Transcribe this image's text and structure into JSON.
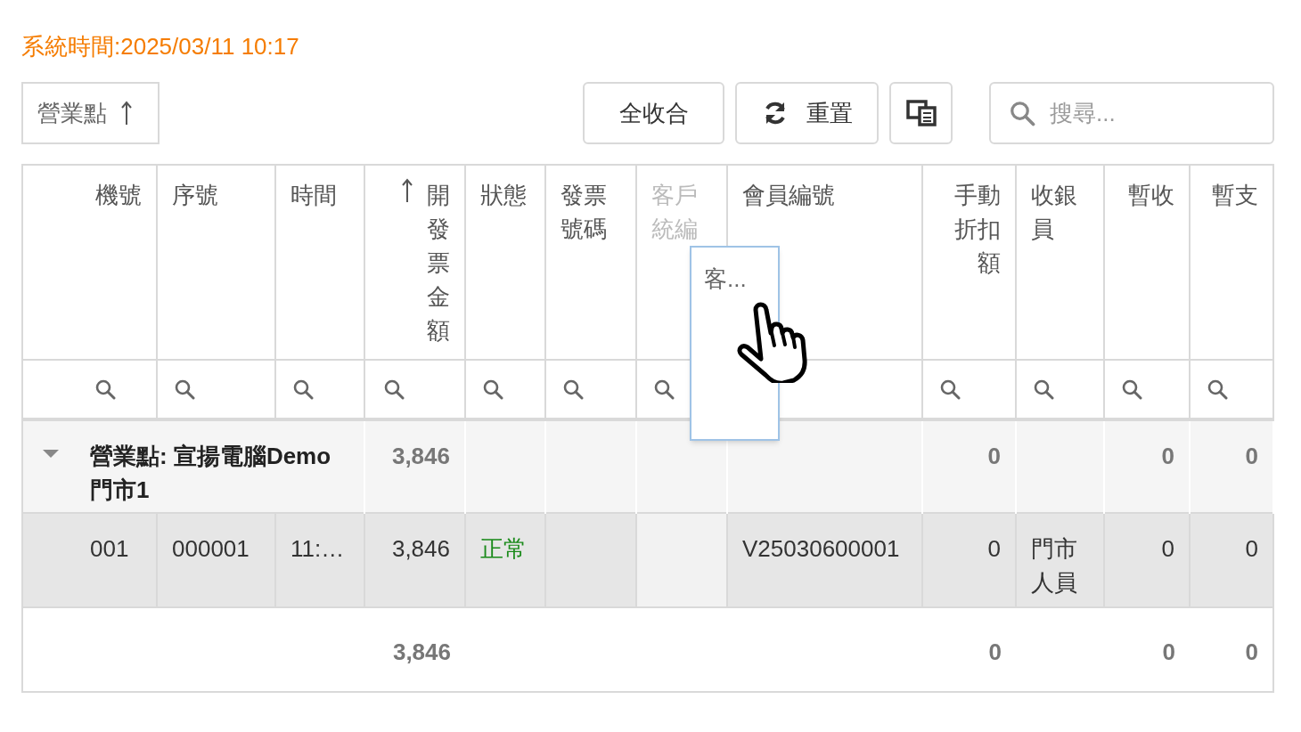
{
  "system_time": "系統時間:2025/03/11 10:17",
  "group_by": {
    "label": "營業點",
    "sorted_ascending": true
  },
  "toolbar": {
    "buttons": [
      {
        "kind": "text",
        "label": "全收合"
      },
      {
        "kind": "refresh",
        "label": "重置"
      },
      {
        "kind": "column-chooser"
      }
    ]
  },
  "search": {
    "placeholder": "搜尋..."
  },
  "table": {
    "columns": [
      {
        "label": "機號",
        "kind": "code",
        "sorted_ascending": false,
        "dragging": false
      },
      {
        "label": "序號",
        "kind": "text",
        "sorted_ascending": false,
        "dragging": false
      },
      {
        "label": "時間",
        "kind": "text",
        "sorted_ascending": false,
        "dragging": false
      },
      {
        "label": "開發票金額",
        "kind": "number",
        "sorted_ascending": true,
        "dragging": false
      },
      {
        "label": "狀態",
        "kind": "status",
        "sorted_ascending": false,
        "dragging": false
      },
      {
        "label": "發票號碼",
        "kind": "text",
        "sorted_ascending": false,
        "dragging": false
      },
      {
        "label": "客戶統編",
        "kind": "text",
        "sorted_ascending": false,
        "dragging": true
      },
      {
        "label": "會員編號",
        "kind": "text",
        "sorted_ascending": false,
        "dragging": false
      },
      {
        "label": "手動折扣額",
        "kind": "number",
        "sorted_ascending": false,
        "dragging": false
      },
      {
        "label": "收銀員",
        "kind": "text",
        "sorted_ascending": false,
        "dragging": false
      },
      {
        "label": "暫收",
        "kind": "number",
        "sorted_ascending": false,
        "dragging": false
      },
      {
        "label": "暫支",
        "kind": "number",
        "sorted_ascending": false,
        "dragging": false
      }
    ],
    "groups": [
      {
        "label": "營業點: 宣揚電腦Demo 門市1",
        "expanded": true,
        "summary": {
          "column_3": "3,846",
          "column_8": "0",
          "column_10": "0",
          "column_11": "0"
        },
        "rows": [
          {
            "column_0": "001",
            "column_1": "000001",
            "column_2": "11:…",
            "column_3": "3,846",
            "column_4": "正常",
            "column_7": "V25030600001",
            "column_8": "0",
            "column_9": "門市人員",
            "column_10": "0",
            "column_11": "0"
          }
        ]
      }
    ],
    "footer": {
      "column_3": "3,846",
      "column_8": "0",
      "column_10": "0",
      "column_11": "0"
    }
  },
  "drag_ghost": {
    "label": "客..."
  }
}
